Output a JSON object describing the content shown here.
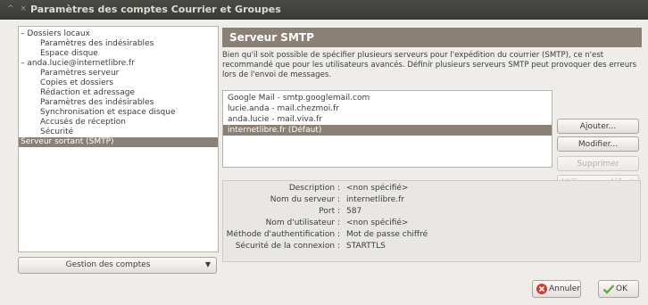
{
  "window": {
    "title": "Paramètres des comptes Courrier et Groupes",
    "controls": "^  ×"
  },
  "tree": {
    "items": [
      {
        "label": "– Dossiers locaux",
        "indent": 0
      },
      {
        "label": "Paramètres des indésirables",
        "indent": 1
      },
      {
        "label": "Espace disque",
        "indent": 1
      },
      {
        "label": "– anda.lucie@internetlibre.fr",
        "indent": 0
      },
      {
        "label": "Paramètres serveur",
        "indent": 1
      },
      {
        "label": "Copies et dossiers",
        "indent": 1
      },
      {
        "label": "Rédaction et adressage",
        "indent": 1
      },
      {
        "label": "Paramètres des indésirables",
        "indent": 1
      },
      {
        "label": "Synchronisation et espace disque",
        "indent": 1
      },
      {
        "label": "Accusés de réception",
        "indent": 1
      },
      {
        "label": "Sécurité",
        "indent": 1
      },
      {
        "label": "Serveur sortant (SMTP)",
        "indent": 0,
        "selected": true
      }
    ]
  },
  "account_actions": {
    "label": "Gestion des comptes",
    "arrow": "▼"
  },
  "main": {
    "title": "Serveur SMTP",
    "description": "Bien qu'il soit possible de spécifier plusieurs serveurs pour l'expédition du courrier (SMTP), ce n'est recommandé que pour les utilisateurs avancés. Définir plusieurs serveurs SMTP peut provoquer des erreurs lors de l'envoi de messages.",
    "servers": [
      {
        "label": "Google Mail - smtp.googlemail.com"
      },
      {
        "label": "lucie.anda - mail.chezmoi.fr"
      },
      {
        "label": "anda.lucie - mail.viva.fr"
      },
      {
        "label": "internetlibre.fr (Défaut)",
        "selected": true
      }
    ],
    "buttons": {
      "add": "Ajouter...",
      "edit": "Modifier...",
      "delete": "Supprimer",
      "set_default": "Utiliser par défaut"
    },
    "details": [
      {
        "key": "Description :",
        "value": "<non spécifié>"
      },
      {
        "key": "Nom du serveur :",
        "value": "internetlibre.fr"
      },
      {
        "key": "Port :",
        "value": "587"
      },
      {
        "key": "Nom d'utilisateur :",
        "value": "<non spécifié>"
      },
      {
        "key": "Méthode d'authentification :",
        "value": "Mot de passe chiffré"
      },
      {
        "key": "Sécurité de la connexion :",
        "value": "STARTTLS"
      }
    ]
  },
  "footer": {
    "cancel": "Annuler",
    "ok": "OK"
  },
  "colors": {
    "selection": "#8a8076",
    "titlebar": "#3f3e3a",
    "cancel_icon": "#d23b2e",
    "ok_icon": "#5fa53a"
  }
}
